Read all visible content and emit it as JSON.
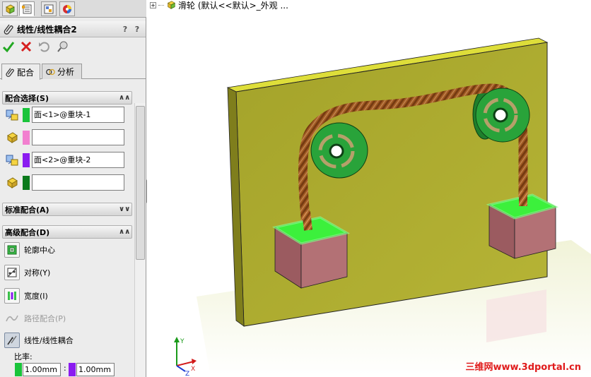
{
  "property_manager": {
    "title": "线性/线性耦合2",
    "help_labels": [
      "?",
      "?"
    ],
    "actions": [
      {
        "name": "ok-button",
        "icon": "check-icon",
        "color": "#21a821"
      },
      {
        "name": "cancel-button",
        "icon": "close-icon",
        "color": "#d61f1f"
      },
      {
        "name": "undo-button",
        "icon": "undo-icon",
        "color": "#9a9a9a"
      },
      {
        "name": "pin-button",
        "icon": "pushpin-icon",
        "color": "#777777"
      }
    ],
    "tabs": [
      {
        "label": "配合",
        "icon": "paperclip-icon",
        "active": true
      },
      {
        "label": "分析",
        "icon": "analysis-icon",
        "active": false
      }
    ]
  },
  "mate_selections": {
    "header": "配合选择(S)",
    "rows": [
      {
        "value": "面<1>@重块-1",
        "swatch": "#19c43a",
        "icon": "entity-select-icon"
      },
      {
        "value": "",
        "swatch": "#f27fcf",
        "icon": "reference-entity-icon"
      },
      {
        "value": "面<2>@重块-2",
        "swatch": "#8b1cf0",
        "icon": "entity-select-icon"
      },
      {
        "value": "",
        "swatch": "#0a7a1c",
        "icon": "reference-entity-icon"
      }
    ]
  },
  "standard_mates": {
    "header": "标准配合(A)"
  },
  "advanced_mates": {
    "header": "高级配合(D)",
    "items": [
      {
        "label": "轮廓中心",
        "icon": "profile-center-icon",
        "enabled": true,
        "active": false
      },
      {
        "label": "对称(Y)",
        "icon": "symmetric-icon",
        "enabled": true,
        "active": false
      },
      {
        "label": "宽度(I)",
        "icon": "width-icon",
        "enabled": true,
        "active": false
      },
      {
        "label": "路径配合(P)",
        "icon": "path-mate-icon",
        "enabled": false,
        "active": false
      },
      {
        "label": "线性/线性耦合",
        "icon": "linear-coupler-icon",
        "enabled": true,
        "active": true
      }
    ],
    "ratio_label": "比率:",
    "ratio_left": "1.00mm",
    "ratio_right": "1.00mm",
    "ratio_left_color": "#19c43a",
    "ratio_right_color": "#8b1cf0"
  },
  "viewport": {
    "tree_label": "滑轮  (默认<<默认>_外观 ...",
    "watermark": "三维网www.3dportal.cn"
  },
  "colors": {
    "board": "#a8a828",
    "pulley": "#29a33a",
    "rope": "#b0652a",
    "block": "#b37175",
    "highlight": "#3cf03c"
  }
}
